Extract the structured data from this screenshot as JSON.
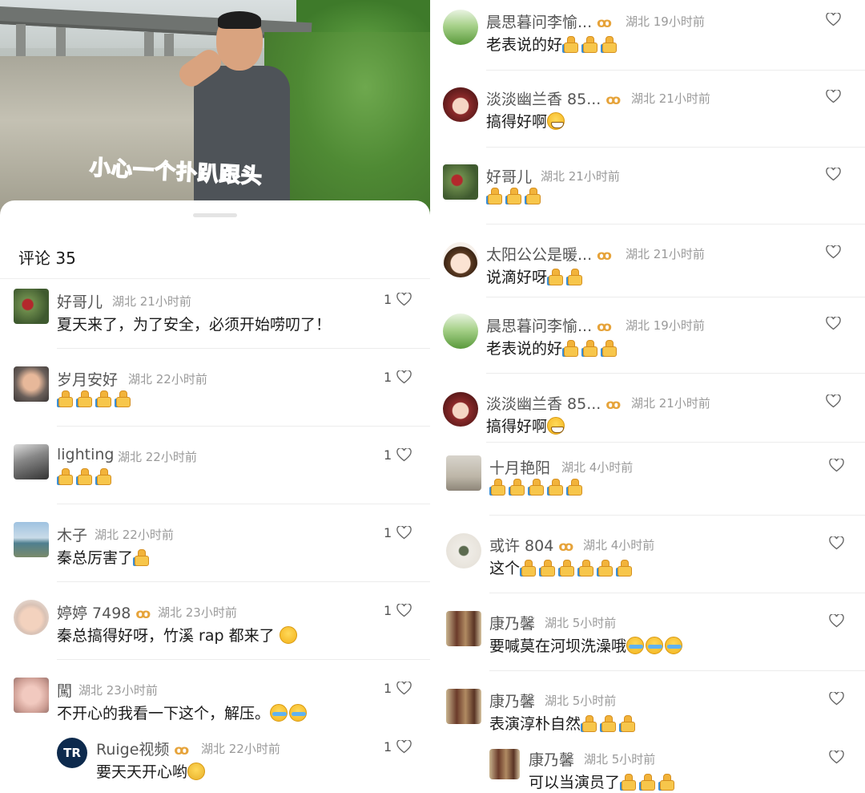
{
  "video": {
    "caption": "小心一个扑趴跟头"
  },
  "left_panel": {
    "title": "评论 35",
    "comments": [
      {
        "name": "好哥儿",
        "meta": "湖北 21小时前",
        "text": "夏天来了，为了安全，必须开始唠叨了！",
        "likes": "1",
        "emoji": "",
        "badge": false,
        "avatar": "cherries"
      },
      {
        "name": "岁月安好",
        "meta": "湖北 22小时前",
        "text": "",
        "likes": "1",
        "emoji": "thumbs-up x4",
        "badge": false,
        "avatar": "child"
      },
      {
        "name": "lighting",
        "meta": "湖北 22小时前",
        "text": "",
        "likes": "1",
        "emoji": "thumbs-up x3",
        "badge": false,
        "avatar": "girl"
      },
      {
        "name": "木子",
        "meta": "湖北 22小时前",
        "text": "秦总厉害了",
        "likes": "1",
        "emoji": "thumbs-up x1",
        "badge": false,
        "avatar": "lake"
      },
      {
        "name": "婷婷 7498",
        "meta": "湖北 23小时前",
        "text": "秦总搞得好呀，竹溪 rap 都来了",
        "likes": "1",
        "emoji": "party-face",
        "badge": true,
        "avatar": "baby"
      },
      {
        "name": "闖",
        "meta": "湖北 23小时前",
        "text": "不开心的我看一下这个，解压。",
        "likes": "1",
        "emoji": "laugh-tears x2",
        "badge": false,
        "avatar": "hand"
      },
      {
        "name": "Ruige视频",
        "meta": "湖北 22小时前",
        "text": "要天天开心哟",
        "likes": "1",
        "emoji": "hug",
        "badge": true,
        "avatar": "TR",
        "reply": true
      }
    ]
  },
  "right_panel": {
    "comments": [
      {
        "name": "晨思暮问李愉...",
        "meta": "湖北 19小时前",
        "text": "老表说的好",
        "emoji": "thumbs-up x3",
        "badge": true,
        "avatar": "grass"
      },
      {
        "name": "淡淡幽兰香 85...",
        "meta": "湖北 21小时前",
        "text": "搞得好啊",
        "emoji": "grin",
        "badge": true,
        "avatar": "woman"
      },
      {
        "name": "好哥儿",
        "meta": "湖北 21小时前",
        "text": "",
        "emoji": "thumbs-up x3",
        "badge": false,
        "avatar": "cherries"
      },
      {
        "name": "太阳公公是暖...",
        "meta": "湖北 21小时前",
        "text": "说滴好呀",
        "emoji": "thumbs-up x2",
        "badge": true,
        "avatar": "cartoon"
      },
      {
        "name": "晨思暮问李愉...",
        "meta": "湖北 19小时前",
        "text": "老表说的好",
        "emoji": "thumbs-up x3",
        "badge": true,
        "avatar": "grass"
      },
      {
        "name": "淡淡幽兰香 85...",
        "meta": "湖北 21小时前",
        "text": "搞得好啊",
        "emoji": "grin",
        "badge": true,
        "avatar": "woman"
      },
      {
        "name": "十月艳阳",
        "meta": "湖北 4小时前",
        "text": "",
        "emoji": "thumbs-up x5",
        "badge": false,
        "avatar": "poster"
      },
      {
        "name": "或许 804",
        "meta": "湖北 4小时前",
        "text": "这个",
        "emoji": "thumbs-up x6",
        "badge": true,
        "avatar": "sketch"
      },
      {
        "name": "康乃馨",
        "meta": "湖北 5小时前",
        "text": "要喊莫在河坝洗澡哦",
        "emoji": "laugh-tears x3",
        "badge": false,
        "avatar": "group"
      },
      {
        "name": "康乃馨",
        "meta": "湖北 5小时前",
        "text": "表演淳朴自然",
        "emoji": "thumbs-up x3",
        "badge": false,
        "avatar": "group"
      },
      {
        "name": "康乃馨",
        "meta": "湖北 5小时前",
        "text": "可以当演员了",
        "emoji": "thumbs-up x3",
        "badge": false,
        "avatar": "group",
        "reply": true
      }
    ]
  },
  "colors": {
    "badge": "#e6a33a",
    "caption": "#e8252b",
    "meta": "#9a9a9a",
    "divider": "#ececec"
  }
}
